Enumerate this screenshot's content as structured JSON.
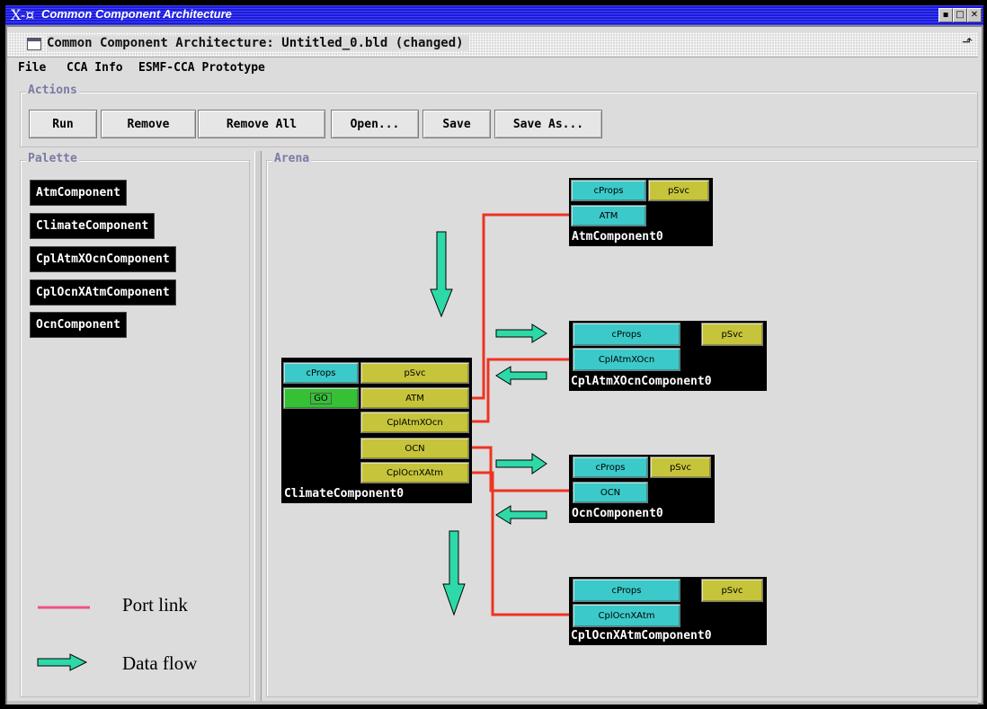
{
  "x_window": {
    "title": "Common Component Architecture",
    "logo": "X-¤"
  },
  "window": {
    "title": "Common Component Architecture: Untitled_0.bld (changed)"
  },
  "menu": [
    "File",
    "CCA Info",
    "ESMF-CCA Prototype"
  ],
  "actions": {
    "label": "Actions",
    "buttons": [
      "Run",
      "Remove",
      "Remove All",
      "Open...",
      "Save",
      "Save As..."
    ]
  },
  "palette": {
    "label": "Palette",
    "items": [
      "AtmComponent",
      "ClimateComponent",
      "CplAtmXOcnComponent",
      "CplOcnXAtmComponent",
      "OcnComponent"
    ]
  },
  "arena": {
    "label": "Arena",
    "components": {
      "climate": {
        "name": "ClimateComponent0",
        "cprops": "cProps",
        "psvc": "pSvc",
        "go": "GO",
        "uses": [
          "ATM",
          "CplAtmXOcn",
          "OCN",
          "CplOcnXAtm"
        ]
      },
      "atm": {
        "name": "AtmComponent0",
        "cprops": "cProps",
        "psvc": "pSvc",
        "provides": "ATM"
      },
      "cplatm": {
        "name": "CplAtmXOcnComponent0",
        "cprops": "cProps",
        "psvc": "pSvc",
        "provides": "CplAtmXOcn"
      },
      "ocn": {
        "name": "OcnComponent0",
        "cprops": "cProps",
        "psvc": "pSvc",
        "provides": "OCN"
      },
      "cplocn": {
        "name": "CplOcnXAtmComponent0",
        "cprops": "cProps",
        "psvc": "pSvc",
        "provides": "CplOcnXAtm"
      }
    }
  },
  "legend": {
    "port_link": "Port link",
    "data_flow": "Data flow"
  },
  "colors": {
    "port_link": "#ee3322",
    "legend_link": "#f0508a",
    "arrow_fill": "#2ed9a8",
    "provides_port": "#3cc9c9",
    "uses_port": "#c6c43a",
    "go_port": "#35c035",
    "title_bar": "#1a1ae0"
  }
}
